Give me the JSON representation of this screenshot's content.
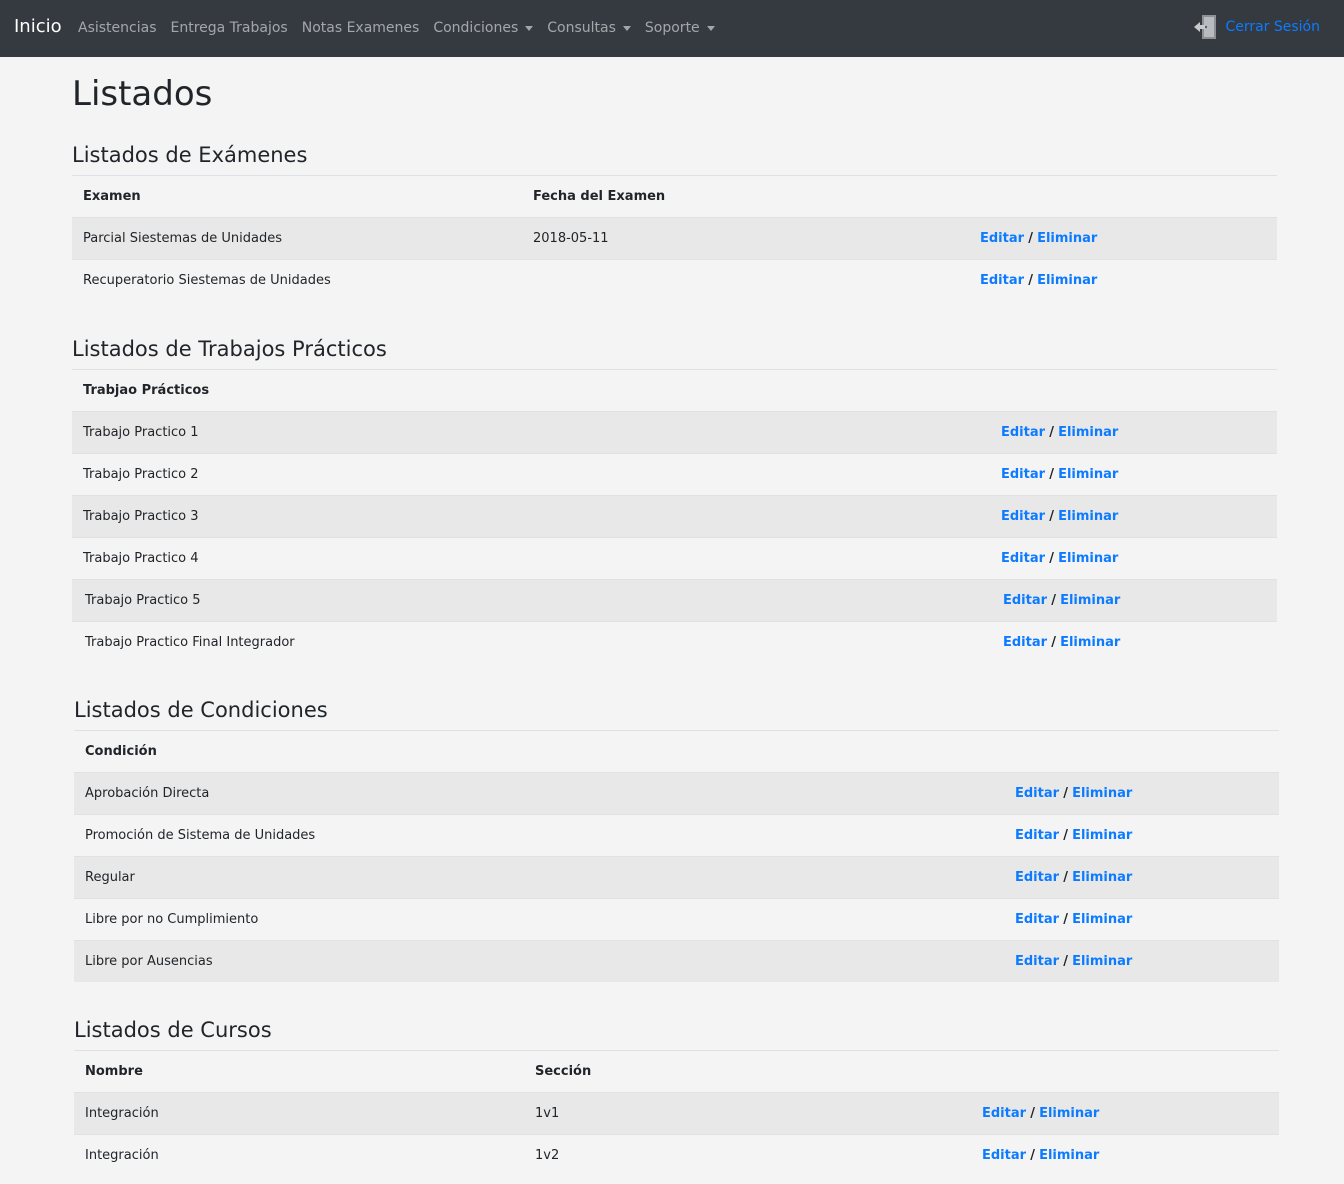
{
  "navbar": {
    "brand": "Inicio",
    "items": [
      {
        "label": "Asistencias"
      },
      {
        "label": "Entrega Trabajos"
      },
      {
        "label": "Notas Examenes"
      },
      {
        "label": "Condiciones"
      },
      {
        "label": "Consultas"
      },
      {
        "label": "Soporte"
      }
    ],
    "logout": "Cerrar Sesión",
    "logout_icon": "door-exit-icon",
    "accent_color": "#0d7bff",
    "background_color": "#343a40"
  },
  "page": {
    "title": "Listados"
  },
  "actions": {
    "edit": "Editar",
    "separator": "/",
    "delete": "Eliminar"
  },
  "examenes": {
    "title": "Listados de Exámenes",
    "headers": [
      "Examen",
      "Fecha del Examen"
    ],
    "rows": [
      {
        "examen": "Parcial Siestemas de Unidades",
        "fecha": "2018-05-11"
      },
      {
        "examen": "Recuperatorio Siestemas de Unidades",
        "fecha": ""
      }
    ]
  },
  "trabajos": {
    "title": "Listados de Trabajos Prácticos",
    "headers": [
      "Trabjao Prácticos"
    ],
    "rows": [
      {
        "nombre": "Trabajo Practico 1"
      },
      {
        "nombre": "Trabajo Practico 2"
      },
      {
        "nombre": "Trabajo Practico 3"
      },
      {
        "nombre": "Trabajo Practico 4"
      },
      {
        "nombre": "Trabajo Practico 5"
      },
      {
        "nombre": "Trabajo Practico Final Integrador"
      }
    ]
  },
  "condiciones": {
    "title": "Listados de Condiciones",
    "headers": [
      "Condición"
    ],
    "rows": [
      {
        "nombre": "Aprobación Directa"
      },
      {
        "nombre": "Promoción de Sistema de Unidades"
      },
      {
        "nombre": "Regular"
      },
      {
        "nombre": "Libre por no Cumplimiento"
      },
      {
        "nombre": "Libre por Ausencias"
      }
    ]
  },
  "cursos": {
    "title": "Listados de Cursos",
    "headers": [
      "Nombre",
      "Sección"
    ],
    "rows": [
      {
        "nombre": "Integración",
        "seccion": "1v1"
      },
      {
        "nombre": "Integración",
        "seccion": "1v2"
      }
    ]
  }
}
